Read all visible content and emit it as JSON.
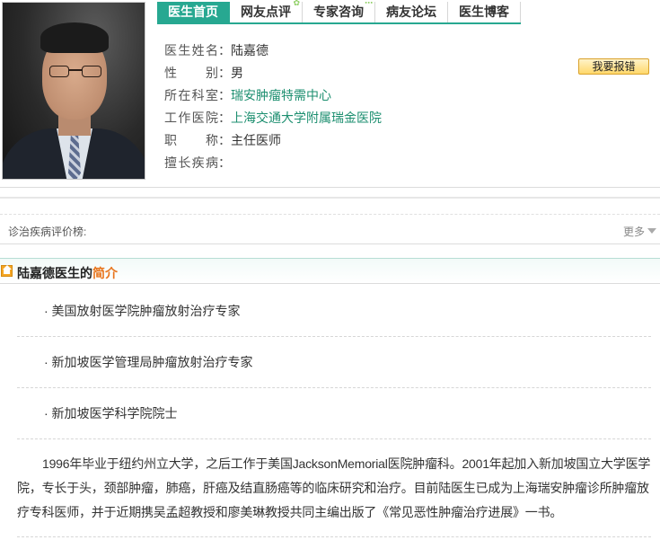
{
  "tabs": [
    "医生首页",
    "网友点评",
    "专家咨询",
    "病友论坛",
    "医生博客"
  ],
  "doctor": {
    "name_label": "医生姓名",
    "name": "陆嘉德",
    "gender_label": "性别",
    "gender": "男",
    "dept_label": "所在科室",
    "dept": "瑞安肿瘤特需中心",
    "hospital_label": "工作医院",
    "hospital": "上海交通大学附属瑞金医院",
    "title_label": "职称",
    "title": "主任医师",
    "specialty_label": "擅长疾病",
    "specialty": "",
    "colon": "："
  },
  "report_button": "我要报错",
  "evaluation": {
    "label": "诊治疾病评价榜:",
    "more": "更多"
  },
  "intro": {
    "heading_prefix": "陆嘉德医生的",
    "heading_suffix": "简介",
    "bullets": [
      "· 美国放射医学院肿瘤放射治疗专家",
      "· 新加坡医学管理局肿瘤放射治疗专家",
      "· 新加坡医学科学院院士"
    ],
    "paragraph": "1996年毕业于纽约州立大学，之后工作于美国JacksonMemorial医院肿瘤科。2001年起加入新加坡国立大学医学院，专长于头，颈部肿瘤，肺癌，肝癌及结直肠癌等的临床研究和治疗。目前陆医生已成为上海瑞安肿瘤诊所肿瘤放疗专科医师，并于近期携吴孟超教授和廖美琳教授共同主编出版了《常见恶性肿瘤治疗进展》一书。"
  },
  "colors": {
    "accent": "#27a891",
    "link": "#1d8f70",
    "heading_orange": "#e8741b"
  }
}
